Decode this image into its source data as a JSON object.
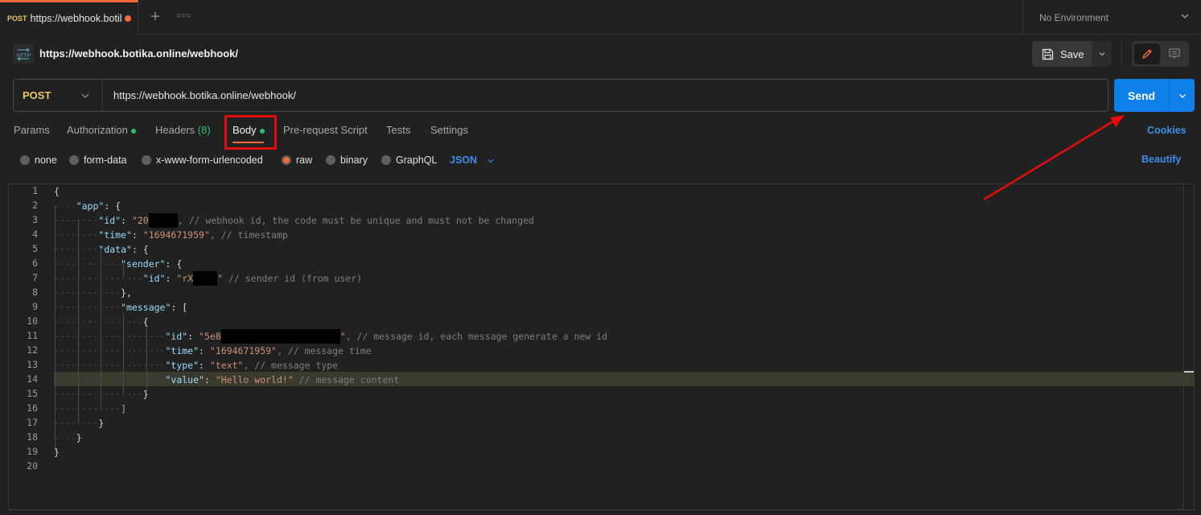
{
  "tabbar": {
    "active_tab": {
      "method": "POST",
      "title": "https://webhook.botil",
      "unsaved": true
    },
    "add_tab_icon": "plus-icon",
    "more_icon": "ellipsis-icon",
    "environment": "No Environment"
  },
  "request": {
    "name": "https://webhook.botika.online/webhook/",
    "icon": "http-icon",
    "save_label": "Save",
    "method": "POST",
    "url": "https://webhook.botika.online/webhook/",
    "send_label": "Send"
  },
  "request_tabs": [
    {
      "label": "Params",
      "indicator": false
    },
    {
      "label": "Authorization",
      "indicator": true
    },
    {
      "label": "Headers",
      "count": "(8)"
    },
    {
      "label": "Body",
      "indicator": true,
      "active": true
    },
    {
      "label": "Pre-request Script"
    },
    {
      "label": "Tests"
    },
    {
      "label": "Settings"
    }
  ],
  "cookies_label": "Cookies",
  "body_types": [
    {
      "label": "none",
      "selected": false
    },
    {
      "label": "form-data",
      "selected": false
    },
    {
      "label": "x-www-form-urlencoded",
      "selected": false
    },
    {
      "label": "raw",
      "selected": true
    },
    {
      "label": "binary",
      "selected": false
    },
    {
      "label": "GraphQL",
      "selected": false
    }
  ],
  "raw_format": "JSON",
  "beautify_label": "Beautify",
  "editor": {
    "line_numbers": [
      "1",
      "2",
      "3",
      "4",
      "5",
      "6",
      "7",
      "8",
      "9",
      "10",
      "11",
      "12",
      "13",
      "14",
      "15",
      "16",
      "17",
      "18",
      "19",
      "20"
    ],
    "highlighted_line": 14,
    "lines": {
      "l1": "{",
      "l2_key": "\"app\"",
      "l2_rest": ": {",
      "l3_key": "\"id\"",
      "l3_val": "\"20",
      "l3_comment": ", // webhook id, the code must be unique and must not be changed",
      "l4_key": "\"time\"",
      "l4_val": "\"1694671959\"",
      "l4_comment": ", // timestamp",
      "l5_key": "\"data\"",
      "l5_rest": ": {",
      "l6_key": "\"sender\"",
      "l6_rest": ": {",
      "l7_key": "\"id\"",
      "l7_val": "\"rX",
      "l7_val_end": "\"",
      "l7_comment": " // sender id (from user)",
      "l8": "},",
      "l9_key": "\"message\"",
      "l9_rest": ": [",
      "l10": "{",
      "l11_key": "\"id\"",
      "l11_val": "\"5e8",
      "l11_val_end": "\"",
      "l11_comment": ", // message id, each message generate a new id",
      "l12_key": "\"time\"",
      "l12_val": "\"1694671959\"",
      "l12_comment": ", // message time",
      "l13_key": "\"type\"",
      "l13_val": "\"text\"",
      "l13_comment": ", // message type",
      "l14_key": "\"value\"",
      "l14_val": "\"Hello world!\"",
      "l14_comment": " // message content",
      "l15": "}",
      "l16": "]",
      "l17": "}",
      "l18": "}",
      "l19": "}"
    }
  },
  "annotations": {
    "highlight_target": "Body tab",
    "arrow_target": "Send button",
    "annotation_color": "#e30d0d"
  },
  "colors": {
    "accent_orange": "#f26b3a",
    "send_blue": "#0f7fea",
    "link_blue": "#3d8ee8",
    "indicator_green": "#2fbf71",
    "method_yellow": "#e6c86a"
  }
}
